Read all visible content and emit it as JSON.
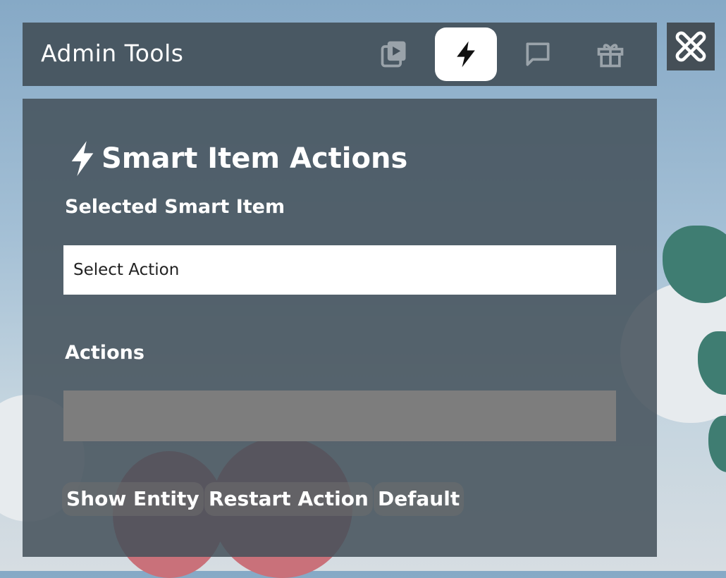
{
  "header": {
    "title": "Admin Tools",
    "tabs": [
      {
        "icon": "video-library-icon",
        "active": false
      },
      {
        "icon": "lightning-icon",
        "active": true
      },
      {
        "icon": "chat-bubble-icon",
        "active": false
      },
      {
        "icon": "gift-icon",
        "active": false
      }
    ],
    "close_icon": "tools-close-icon"
  },
  "panel": {
    "title": "Smart Item Actions",
    "title_icon": "lightning-icon",
    "selected_label": "Selected Smart Item",
    "select_value": "Select Action",
    "actions_label": "Actions",
    "buttons": {
      "show_entity": "Show Entity",
      "restart_action": "Restart Action",
      "default": "Default"
    }
  },
  "colors": {
    "panel_bg": "#43505a",
    "active_tab_bg": "#ffffff",
    "icon_inactive": "#9aa3aa"
  }
}
